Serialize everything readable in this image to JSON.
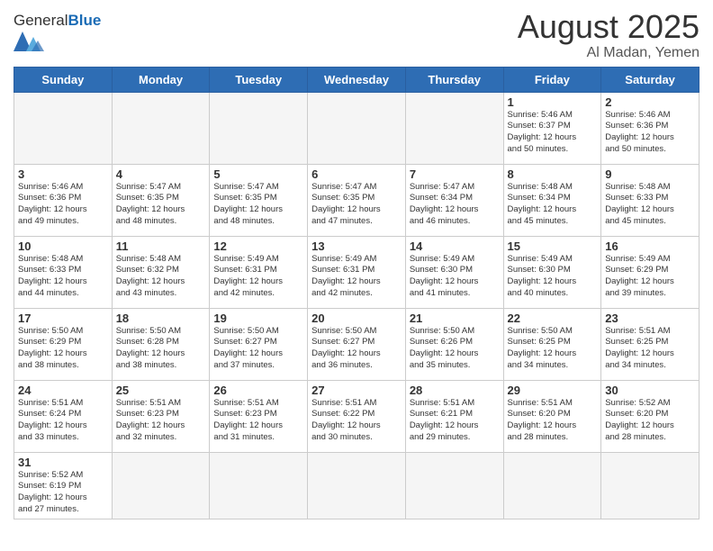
{
  "header": {
    "logo_general": "General",
    "logo_blue": "Blue",
    "month_year": "August 2025",
    "location": "Al Madan, Yemen"
  },
  "days_of_week": [
    "Sunday",
    "Monday",
    "Tuesday",
    "Wednesday",
    "Thursday",
    "Friday",
    "Saturday"
  ],
  "weeks": [
    [
      {
        "day": "",
        "info": ""
      },
      {
        "day": "",
        "info": ""
      },
      {
        "day": "",
        "info": ""
      },
      {
        "day": "",
        "info": ""
      },
      {
        "day": "",
        "info": ""
      },
      {
        "day": "1",
        "info": "Sunrise: 5:46 AM\nSunset: 6:37 PM\nDaylight: 12 hours\nand 50 minutes."
      },
      {
        "day": "2",
        "info": "Sunrise: 5:46 AM\nSunset: 6:36 PM\nDaylight: 12 hours\nand 50 minutes."
      }
    ],
    [
      {
        "day": "3",
        "info": "Sunrise: 5:46 AM\nSunset: 6:36 PM\nDaylight: 12 hours\nand 49 minutes."
      },
      {
        "day": "4",
        "info": "Sunrise: 5:47 AM\nSunset: 6:35 PM\nDaylight: 12 hours\nand 48 minutes."
      },
      {
        "day": "5",
        "info": "Sunrise: 5:47 AM\nSunset: 6:35 PM\nDaylight: 12 hours\nand 48 minutes."
      },
      {
        "day": "6",
        "info": "Sunrise: 5:47 AM\nSunset: 6:35 PM\nDaylight: 12 hours\nand 47 minutes."
      },
      {
        "day": "7",
        "info": "Sunrise: 5:47 AM\nSunset: 6:34 PM\nDaylight: 12 hours\nand 46 minutes."
      },
      {
        "day": "8",
        "info": "Sunrise: 5:48 AM\nSunset: 6:34 PM\nDaylight: 12 hours\nand 45 minutes."
      },
      {
        "day": "9",
        "info": "Sunrise: 5:48 AM\nSunset: 6:33 PM\nDaylight: 12 hours\nand 45 minutes."
      }
    ],
    [
      {
        "day": "10",
        "info": "Sunrise: 5:48 AM\nSunset: 6:33 PM\nDaylight: 12 hours\nand 44 minutes."
      },
      {
        "day": "11",
        "info": "Sunrise: 5:48 AM\nSunset: 6:32 PM\nDaylight: 12 hours\nand 43 minutes."
      },
      {
        "day": "12",
        "info": "Sunrise: 5:49 AM\nSunset: 6:31 PM\nDaylight: 12 hours\nand 42 minutes."
      },
      {
        "day": "13",
        "info": "Sunrise: 5:49 AM\nSunset: 6:31 PM\nDaylight: 12 hours\nand 42 minutes."
      },
      {
        "day": "14",
        "info": "Sunrise: 5:49 AM\nSunset: 6:30 PM\nDaylight: 12 hours\nand 41 minutes."
      },
      {
        "day": "15",
        "info": "Sunrise: 5:49 AM\nSunset: 6:30 PM\nDaylight: 12 hours\nand 40 minutes."
      },
      {
        "day": "16",
        "info": "Sunrise: 5:49 AM\nSunset: 6:29 PM\nDaylight: 12 hours\nand 39 minutes."
      }
    ],
    [
      {
        "day": "17",
        "info": "Sunrise: 5:50 AM\nSunset: 6:29 PM\nDaylight: 12 hours\nand 38 minutes."
      },
      {
        "day": "18",
        "info": "Sunrise: 5:50 AM\nSunset: 6:28 PM\nDaylight: 12 hours\nand 38 minutes."
      },
      {
        "day": "19",
        "info": "Sunrise: 5:50 AM\nSunset: 6:27 PM\nDaylight: 12 hours\nand 37 minutes."
      },
      {
        "day": "20",
        "info": "Sunrise: 5:50 AM\nSunset: 6:27 PM\nDaylight: 12 hours\nand 36 minutes."
      },
      {
        "day": "21",
        "info": "Sunrise: 5:50 AM\nSunset: 6:26 PM\nDaylight: 12 hours\nand 35 minutes."
      },
      {
        "day": "22",
        "info": "Sunrise: 5:50 AM\nSunset: 6:25 PM\nDaylight: 12 hours\nand 34 minutes."
      },
      {
        "day": "23",
        "info": "Sunrise: 5:51 AM\nSunset: 6:25 PM\nDaylight: 12 hours\nand 34 minutes."
      }
    ],
    [
      {
        "day": "24",
        "info": "Sunrise: 5:51 AM\nSunset: 6:24 PM\nDaylight: 12 hours\nand 33 minutes."
      },
      {
        "day": "25",
        "info": "Sunrise: 5:51 AM\nSunset: 6:23 PM\nDaylight: 12 hours\nand 32 minutes."
      },
      {
        "day": "26",
        "info": "Sunrise: 5:51 AM\nSunset: 6:23 PM\nDaylight: 12 hours\nand 31 minutes."
      },
      {
        "day": "27",
        "info": "Sunrise: 5:51 AM\nSunset: 6:22 PM\nDaylight: 12 hours\nand 30 minutes."
      },
      {
        "day": "28",
        "info": "Sunrise: 5:51 AM\nSunset: 6:21 PM\nDaylight: 12 hours\nand 29 minutes."
      },
      {
        "day": "29",
        "info": "Sunrise: 5:51 AM\nSunset: 6:20 PM\nDaylight: 12 hours\nand 28 minutes."
      },
      {
        "day": "30",
        "info": "Sunrise: 5:52 AM\nSunset: 6:20 PM\nDaylight: 12 hours\nand 28 minutes."
      }
    ],
    [
      {
        "day": "31",
        "info": "Sunrise: 5:52 AM\nSunset: 6:19 PM\nDaylight: 12 hours\nand 27 minutes."
      },
      {
        "day": "",
        "info": ""
      },
      {
        "day": "",
        "info": ""
      },
      {
        "day": "",
        "info": ""
      },
      {
        "day": "",
        "info": ""
      },
      {
        "day": "",
        "info": ""
      },
      {
        "day": "",
        "info": ""
      }
    ]
  ]
}
